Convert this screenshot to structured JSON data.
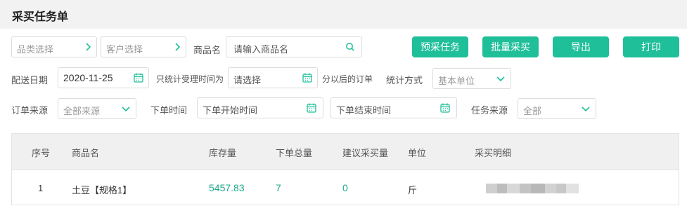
{
  "page": {
    "title": "采买任务单"
  },
  "filters": {
    "category": {
      "placeholder": "品类选择"
    },
    "customer": {
      "placeholder": "客户选择"
    },
    "product_name": {
      "label": "商品名",
      "placeholder": "请输入商品名"
    },
    "delivery_date": {
      "label": "配送日期",
      "value": "2020-11-25"
    },
    "acceptance_time": {
      "label": "只统计受理时间为",
      "placeholder": "请选择",
      "suffix": "分以后的订单"
    },
    "stat_method": {
      "label": "统计方式",
      "value": "基本单位"
    },
    "order_source": {
      "label": "订单来源",
      "value": "全部来源"
    },
    "order_time": {
      "label": "下单时间",
      "start_placeholder": "下单开始时间",
      "end_placeholder": "下单结束时间"
    },
    "task_source": {
      "label": "任务来源",
      "value": "全部"
    }
  },
  "actions": {
    "pre_purchase": "预采任务",
    "batch_purchase": "批量采买",
    "export": "导出",
    "print": "打印"
  },
  "colors": {
    "accent": "#1fbf9a",
    "accent_text": "#1fa88a"
  },
  "table": {
    "headers": {
      "index": "序号",
      "name": "商品名",
      "stock": "库存量",
      "total_ordered": "下单总量",
      "suggested": "建议采买量",
      "unit": "单位",
      "detail": "采买明细"
    },
    "rows": [
      {
        "index": "1",
        "name": "土豆【规格1】",
        "stock": "5457.83",
        "total_ordered": "7",
        "suggested": "0",
        "unit": "斤"
      }
    ]
  }
}
